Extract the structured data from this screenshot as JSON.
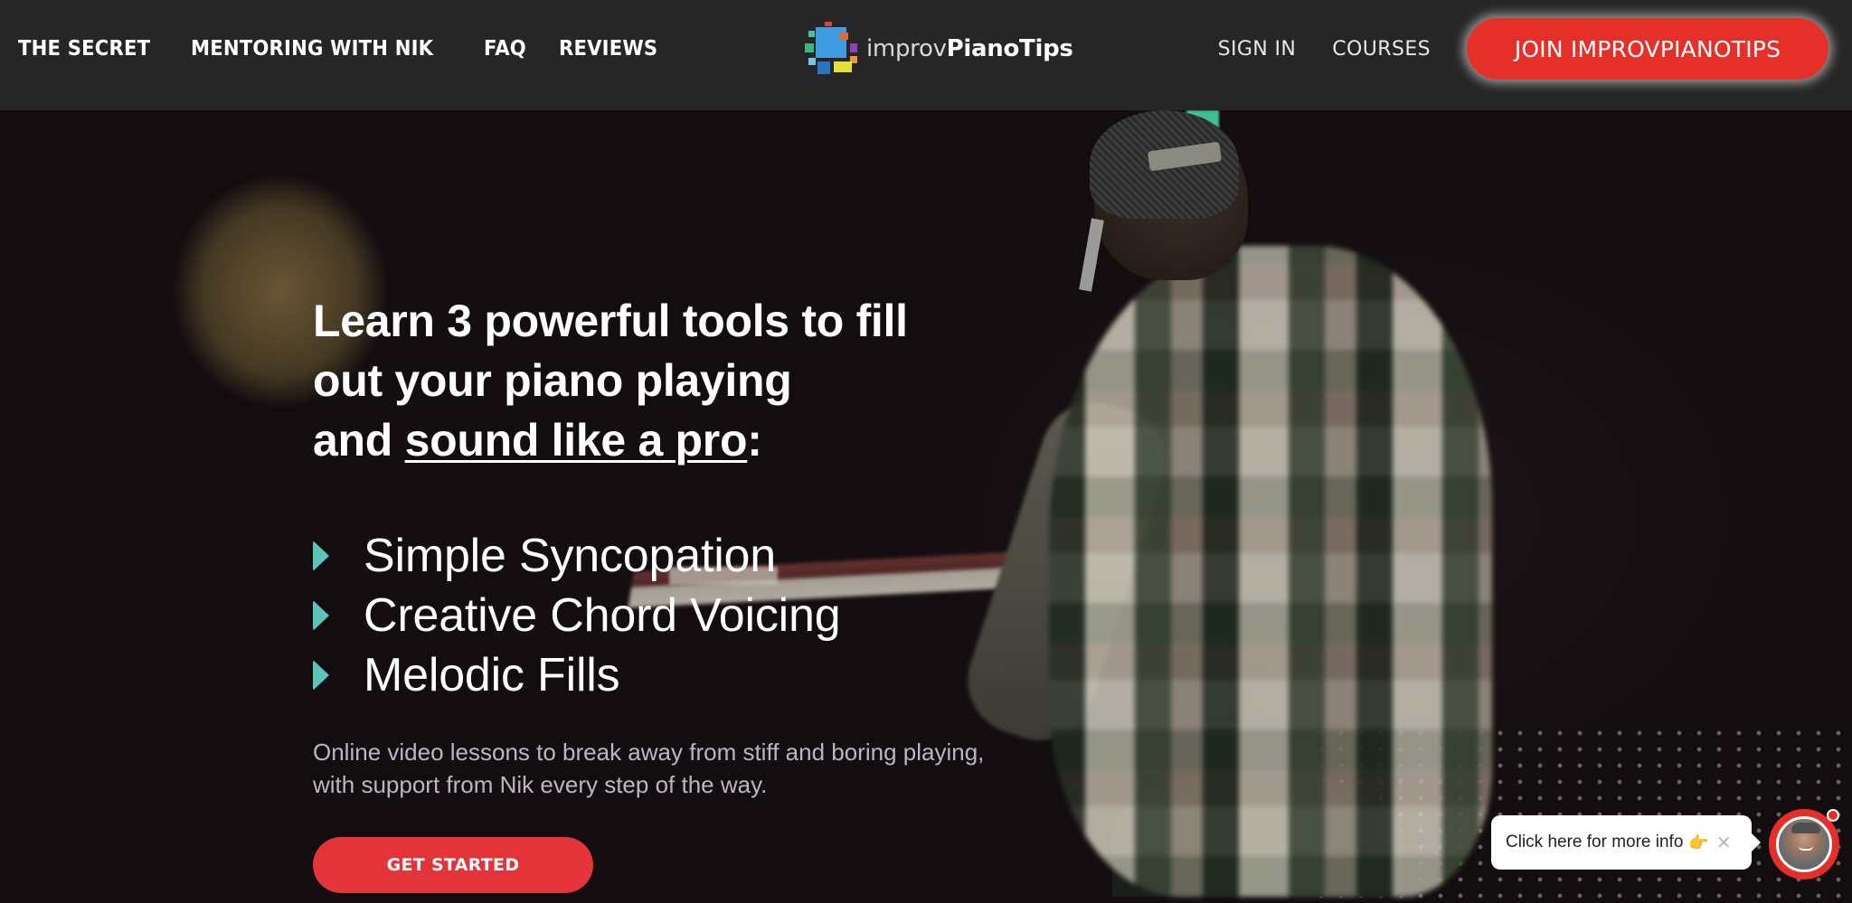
{
  "nav": {
    "left_links": [
      {
        "label": "THE SECRET"
      },
      {
        "label": "MENTORING WITH NIK"
      },
      {
        "label": "FAQ"
      },
      {
        "label": "REVIEWS"
      }
    ],
    "logo": {
      "light": "improv",
      "bold": "PianoTips"
    },
    "sign_in": "SIGN IN",
    "courses": "COURSES",
    "join_button": "JOIN IMPROVPIANOTIPS"
  },
  "hero": {
    "headline_line1": "Learn 3 powerful tools to fill",
    "headline_line2": "out your piano playing",
    "headline_line3_prefix": "and ",
    "headline_line3_underlined": "sound like a pro",
    "headline_line3_suffix": ":",
    "features": [
      {
        "label": "Simple Syncopation",
        "icon": "triangle-bullet-icon"
      },
      {
        "label": "Creative Chord Voicing",
        "icon": "triangle-bullet-icon"
      },
      {
        "label": "Melodic Fills",
        "icon": "triangle-bullet-icon"
      }
    ],
    "subtitle": "Online video lessons to break away from stiff and boring playing, with support from Nik every step of the way.",
    "cta": "GET STARTED"
  },
  "chat_widget": {
    "message": "Click here for more info",
    "emoji": "👉",
    "close": "✕"
  },
  "colors": {
    "accent_red": "#e5302a",
    "bullet_teal": "#5ac6b9",
    "navbar_bg": "#262626",
    "hero_bg": "#130d10"
  }
}
